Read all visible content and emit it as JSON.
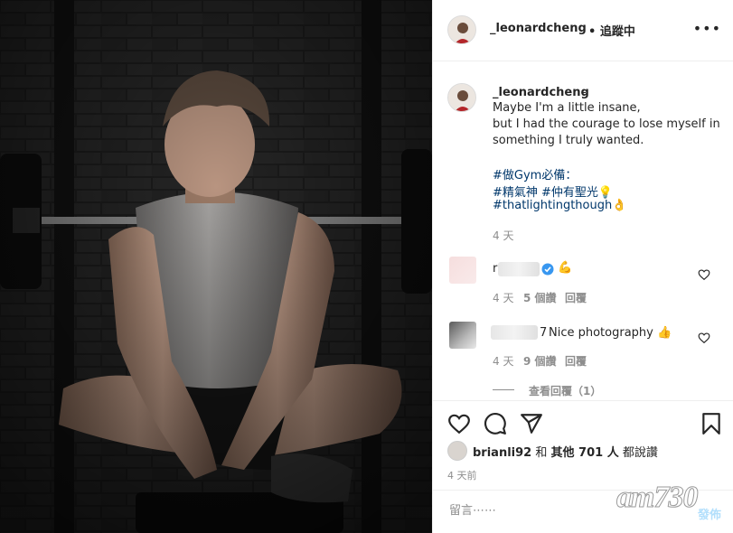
{
  "header": {
    "username": "_leonardcheng",
    "follow_status": "• 追蹤中",
    "more": "•••"
  },
  "caption": {
    "username": "_leonardcheng",
    "dash": "-",
    "lines": [
      "Maybe I'm a little insane,",
      "but I had the courage to lose myself in",
      "something I truly wanted."
    ],
    "hashtags": [
      "#做Gym必備：",
      "#精氣神 #仲有聖光💡",
      "#thatlightingthough👌"
    ],
    "time": "4 天"
  },
  "comments": [
    {
      "username": "r",
      "verified": true,
      "text": "💪",
      "time": "4 天",
      "likes": "5 個讚",
      "reply": "回覆"
    },
    {
      "username": "7",
      "text": "Nice photography 👍",
      "time": "4 天",
      "likes": "9 個讚",
      "reply": "回覆"
    }
  ],
  "view_replies": "查看回覆（1）",
  "likes": {
    "user": "brianli92",
    "and": "和",
    "others": "其他 701 人",
    "suffix": "都說讚"
  },
  "posted": "4 天前",
  "comment_box": {
    "placeholder": "留言⋯⋯",
    "post_label": "發佈"
  },
  "watermark": "am730",
  "icons": [
    "heart-icon",
    "comment-icon",
    "share-icon",
    "bookmark-icon",
    "verified-icon"
  ]
}
